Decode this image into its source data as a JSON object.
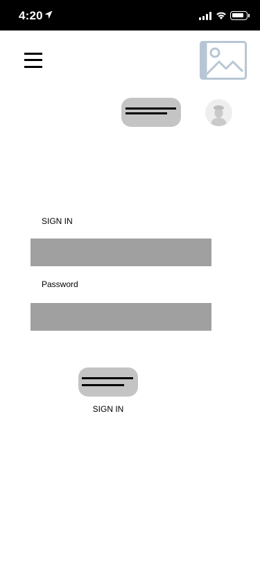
{
  "status_bar": {
    "time": "4:20",
    "icons": [
      "location-arrow-icon",
      "cellular-signal-icon",
      "wifi-icon",
      "battery-icon"
    ]
  },
  "header": {
    "menu_icon": "hamburger-menu-icon",
    "image_icon": "image-placeholder-icon",
    "avatar_icon": "user-avatar-icon"
  },
  "form": {
    "username_label": "SIGN IN",
    "username_value": "",
    "password_label": "Password",
    "password_value": ""
  },
  "submit": {
    "caption": "SIGN IN"
  },
  "colors": {
    "status_bar_bg": "#000000",
    "pill_bg": "#c4c4c4",
    "field_bg": "#a0a0a0",
    "placeholder_image": "#b7c6d4"
  }
}
